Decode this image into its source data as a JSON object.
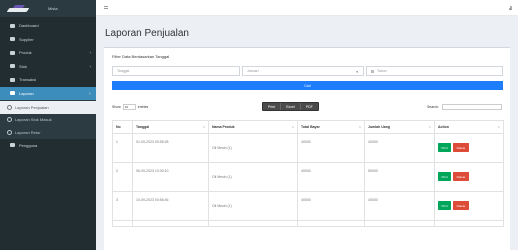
{
  "brand": {
    "name": "Mista"
  },
  "sidebar": {
    "items": [
      {
        "label": "Dashboard",
        "icon": "dashboard-icon",
        "chevron": ""
      },
      {
        "label": "Supplier",
        "icon": "truck-icon",
        "chevron": ""
      },
      {
        "label": "Produk",
        "icon": "box-icon",
        "chevron": "›"
      },
      {
        "label": "Stok",
        "icon": "stock-icon",
        "chevron": "›"
      },
      {
        "label": "Transaksi",
        "icon": "cart-icon",
        "chevron": ""
      },
      {
        "label": "Laporan",
        "icon": "report-icon",
        "chevron": "˄"
      }
    ],
    "subitems": [
      {
        "label": "Laporan Penjualan"
      },
      {
        "label": "Laporan Stok Masuk"
      },
      {
        "label": "Laporan Retur"
      }
    ],
    "extra": {
      "label": "Pengguna",
      "icon": "user-icon"
    }
  },
  "page": {
    "title": "Laporan Penjualan"
  },
  "filter": {
    "title": "Filter Data Berdasarkan Tanggal",
    "date_placeholder": "Tanggal",
    "month_value": "Januari",
    "year_placeholder": "Tahun",
    "submit_label": "Cari"
  },
  "table_controls": {
    "show_label": "Show",
    "entries_value": "10",
    "entries_label": "entries",
    "export_buttons": [
      "Print",
      "Excel",
      "PDF"
    ],
    "search_label": "Search:"
  },
  "table": {
    "columns": [
      "No",
      "Tanggal",
      "Nama Produk",
      "Total Bayar",
      "Jumlah Uang",
      "Action"
    ],
    "rows": [
      {
        "no": "1",
        "tanggal": "01-09-2023 09:55:28",
        "produk": "Oli Mesin (1)",
        "total": "40000",
        "jumlah": "40000"
      },
      {
        "no": "2",
        "tanggal": "06-09-2023 10:00:10",
        "produk": "Oli Mesin (1)",
        "total": "40000",
        "jumlah": "50000"
      },
      {
        "no": "3",
        "tanggal": "10-09-2023 00:56:46",
        "produk": "Oli Mesin (1)",
        "total": "40000",
        "jumlah": "40000"
      }
    ],
    "print_label": "Print",
    "delete_label": "Delete"
  },
  "colors": {
    "sidebar_bg": "#222d32",
    "active_blue": "#3c8dbc",
    "button_blue": "#1d7dfa",
    "print_green": "#00a65a",
    "delete_red": "#dd4b39"
  }
}
